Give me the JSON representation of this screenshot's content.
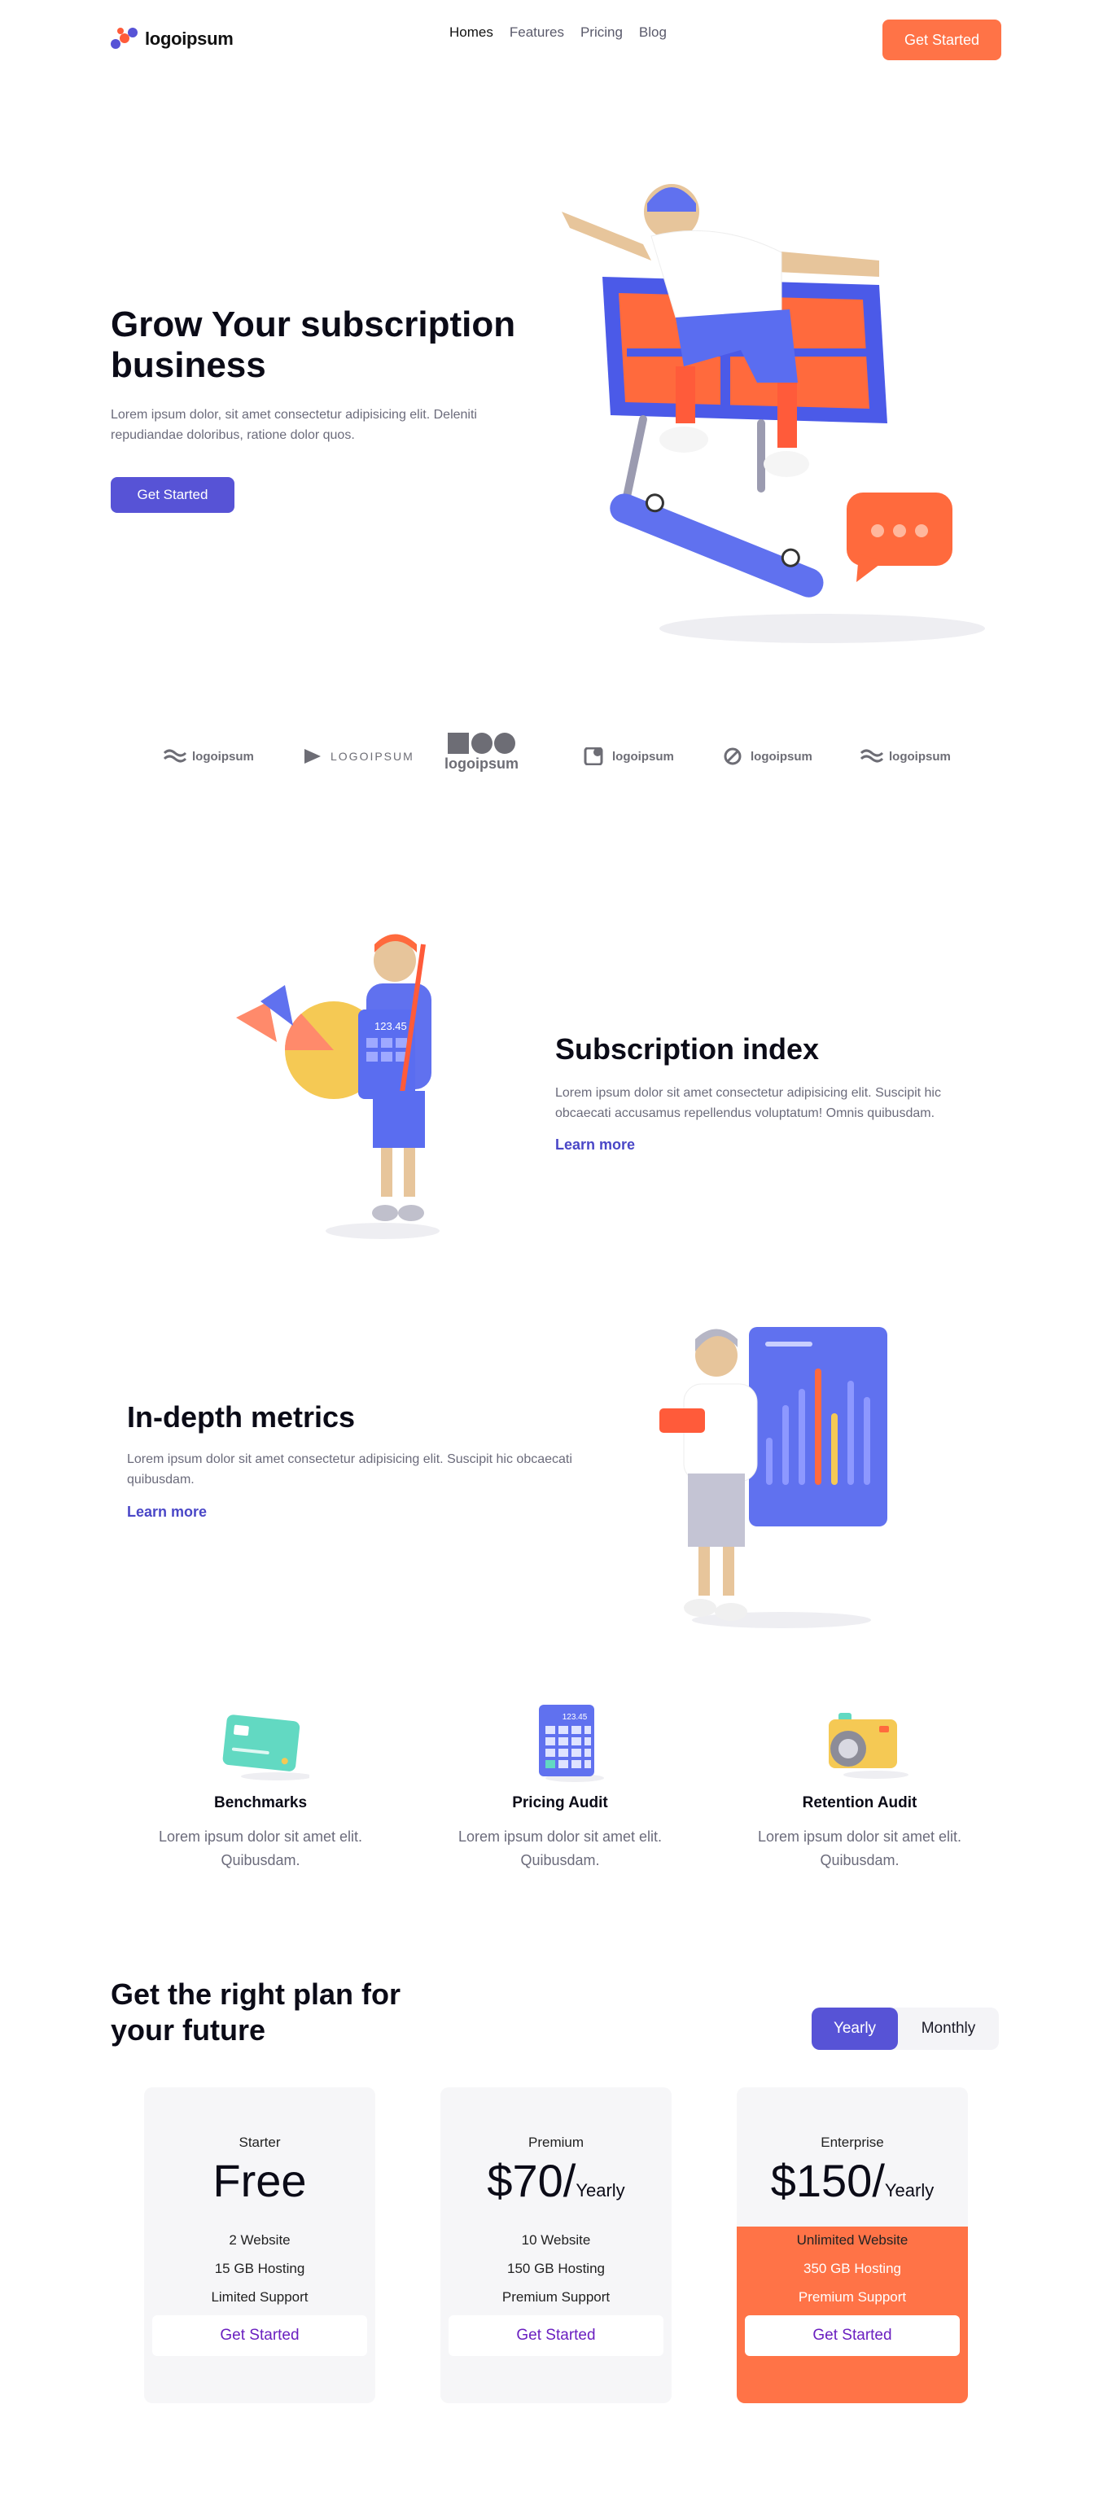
{
  "nav": {
    "logo_text": "logoipsum",
    "links": [
      "Homes",
      "Features",
      "Pricing",
      "Blog"
    ],
    "cta": "Get Started"
  },
  "hero": {
    "title": "Grow Your subscription business",
    "text": "Lorem ipsum dolor, sit amet consectetur adipisicing elit. Deleniti repudiandae doloribus, ratione dolor quos.",
    "cta": "Get Started",
    "illustration_icon": "skateboarder-bookshelf-illustration"
  },
  "brands": [
    "logoipsum",
    "LOGOIPSUM",
    "logoipsum",
    "logoipsum",
    "logoipsum",
    "logoipsum"
  ],
  "feature1": {
    "title": "Subscription index",
    "text": "Lorem ipsum dolor sit amet consectetur adipisicing elit. Suscipit hic obcaecati accusamus repellendus voluptatum! Omnis quibusdam.",
    "link": "Learn more",
    "calc_display": "123.45"
  },
  "feature2": {
    "title": "In-depth metrics",
    "text": "Lorem ipsum dolor sit amet consectetur adipisicing elit. Suscipit hic obcaecati quibusdam.",
    "link": "Learn more"
  },
  "columns": [
    {
      "title": "Benchmarks",
      "text": "Lorem ipsum dolor sit amet elit. Quibusdam.",
      "icon": "credit-card-icon"
    },
    {
      "title": "Pricing Audit",
      "text": "Lorem ipsum dolor sit amet elit. Quibusdam.",
      "icon": "calculator-icon"
    },
    {
      "title": "Retention Audit",
      "text": "Lorem ipsum dolor sit amet elit. Quibusdam.",
      "icon": "camera-icon"
    }
  ],
  "pricing": {
    "title": "Get the right plan for your future",
    "toggle": {
      "yearly": "Yearly",
      "monthly": "Monthly",
      "selected": "Yearly"
    },
    "plans": [
      {
        "tier": "Starter",
        "price": "Free",
        "period": "",
        "features": [
          "2 Website",
          "15 GB Hosting",
          "Limited Support"
        ],
        "cta": "Get Started"
      },
      {
        "tier": "Premium",
        "price": "$70/",
        "period": "Yearly",
        "features": [
          "10 Website",
          "150 GB Hosting",
          "Premium Support"
        ],
        "cta": "Get Started"
      },
      {
        "tier": "Enterprise",
        "price": "$150/",
        "period": "Yearly",
        "features": [
          "Unlimited Website",
          "350 GB Hosting",
          "Premium Support"
        ],
        "cta": "Get Started"
      }
    ]
  },
  "colors": {
    "accent": "#5753d6",
    "orange": "#ff7347",
    "muted": "#6b6b7b"
  }
}
